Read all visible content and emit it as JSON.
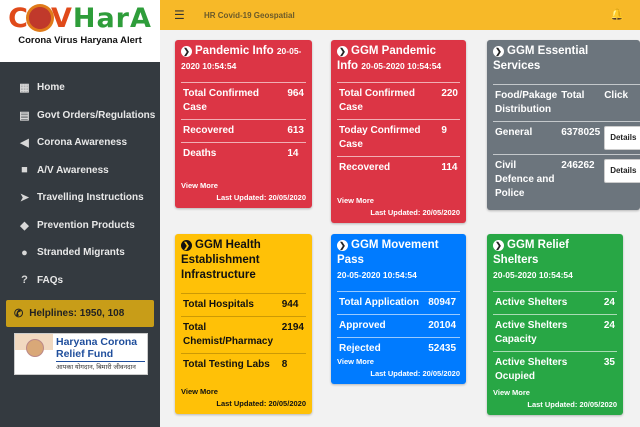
{
  "brand": {
    "tagline": "Corona Virus Haryana Alert"
  },
  "sidebar": {
    "items": [
      {
        "label": "Home",
        "icon": "grid-icon"
      },
      {
        "label": "Govt Orders/Regulations",
        "icon": "document-icon"
      },
      {
        "label": "Corona Awareness",
        "icon": "megaphone-icon"
      },
      {
        "label": "A/V Awareness",
        "icon": "video-icon"
      },
      {
        "label": "Travelling Instructions",
        "icon": "paper-plane-icon"
      },
      {
        "label": "Prevention Products",
        "icon": "cube-icon"
      },
      {
        "label": "Stranded Migrants",
        "icon": "users-icon"
      },
      {
        "label": "FAQs",
        "icon": "question-icon"
      }
    ],
    "helpline": "Helplines: 1950, 108",
    "relief_fund": {
      "line1": "Haryana Corona",
      "line2": "Relief Fund",
      "line3": "आपका योगदान, बिमारी जीवनदान"
    }
  },
  "topbar": {
    "title": "HR Covid-19 Geospatial"
  },
  "cards": {
    "pandemic": {
      "title": "Pandemic Info",
      "date": "20-05-2020 10:54:54",
      "rows": [
        {
          "label": "Total Confirmed Case",
          "value": "964"
        },
        {
          "label": "Recovered",
          "value": "613"
        },
        {
          "label": "Deaths",
          "value": "14"
        }
      ],
      "more": "View More",
      "updated": "Last Updated: 20/05/2020"
    },
    "ggm_pandemic": {
      "title": "GGM Pandemic Info",
      "date": "20-05-2020 10:54:54",
      "rows": [
        {
          "label": "Total Confirmed Case",
          "value": "220"
        },
        {
          "label": "Today Confirmed Case",
          "value": "9"
        },
        {
          "label": "Recovered",
          "value": "114"
        }
      ],
      "more": "View More",
      "updated": "Last Updated: 20/05/2020"
    },
    "essential": {
      "title": "GGM Essential Services",
      "rows": [
        {
          "label": "Food/Pakage Distribution",
          "value": "Total",
          "extra": "Click"
        },
        {
          "label": "General",
          "value": "6378025",
          "extra": "Details"
        },
        {
          "label": "Civil Defence and Police",
          "value": "246262",
          "extra": "Details"
        }
      ]
    },
    "health": {
      "title": "GGM Health Establishment Infrastructure",
      "rows": [
        {
          "label": "Total Hospitals",
          "value": "944"
        },
        {
          "label": "Total Chemist/Pharmacy",
          "value": "2194"
        },
        {
          "label": "Total Testing Labs",
          "value": "8"
        }
      ],
      "more": "View More",
      "updated": "Last Updated: 20/05/2020"
    },
    "movement": {
      "title": "GGM Movement Pass",
      "date": "20-05-2020 10:54:54",
      "rows": [
        {
          "label": "Total Application",
          "value": "80947"
        },
        {
          "label": "Approved",
          "value": "20104"
        },
        {
          "label": "Rejected",
          "value": "52435"
        }
      ],
      "more": "View More",
      "updated": "Last Updated: 20/05/2020"
    },
    "shelters": {
      "title": "GGM Relief Shelters",
      "date": "20-05-2020 10:54:54",
      "rows": [
        {
          "label": "Active Shelters",
          "value": "24"
        },
        {
          "label": "Active Shelters Capacity",
          "value": "24"
        },
        {
          "label": "Active Shelters Ocupied",
          "value": "35"
        }
      ],
      "more": "View More",
      "updated": "Last Updated: 20/05/2020"
    }
  },
  "colors": {
    "red": "#dc3545",
    "blue": "#007bff",
    "gray": "#6c757d",
    "yellow": "#ffc107",
    "green": "#28a745",
    "sidebar": "#343a40",
    "topbar": "#f7b928"
  }
}
